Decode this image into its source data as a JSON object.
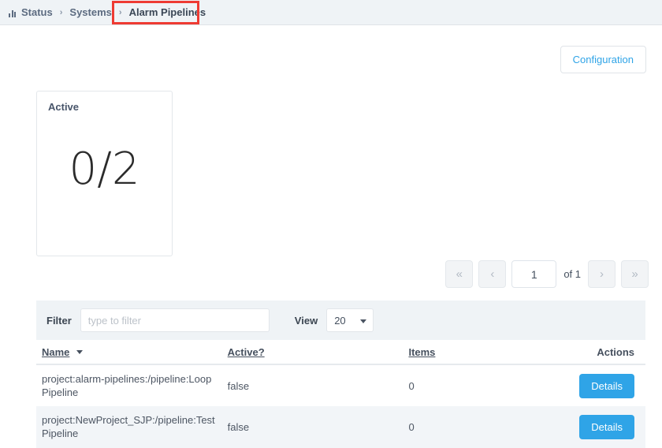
{
  "breadcrumb": {
    "icon": "bar-chart-icon",
    "items": [
      {
        "label": "Status",
        "current": false
      },
      {
        "label": "Systems",
        "current": false
      },
      {
        "label": "Alarm Pipelines",
        "current": true
      }
    ],
    "separator": "›",
    "highlight_color": "#ee3b33"
  },
  "toolbar": {
    "configuration_label": "Configuration"
  },
  "card": {
    "title": "Active",
    "value": "0/2"
  },
  "pagination": {
    "first_label": "«",
    "prev_label": "‹",
    "page_value": "1",
    "of_label": "of 1",
    "next_label": "›",
    "last_label": "»"
  },
  "filter": {
    "label": "Filter",
    "placeholder": "type to filter",
    "value": "",
    "view_label": "View",
    "view_value": "20"
  },
  "table": {
    "columns": [
      {
        "label": "Name",
        "sortable": true,
        "sorted": true
      },
      {
        "label": "Active?",
        "sortable": true,
        "sorted": false
      },
      {
        "label": "Items",
        "sortable": true,
        "sorted": false
      },
      {
        "label": "Actions",
        "sortable": false,
        "sorted": false
      }
    ],
    "rows": [
      {
        "name": "project:alarm-pipelines:/pipeline:Loop Pipeline",
        "active": "false",
        "items": "0",
        "action_label": "Details"
      },
      {
        "name": "project:NewProject_SJP:/pipeline:Test Pipeline",
        "active": "false",
        "items": "0",
        "action_label": "Details"
      }
    ]
  },
  "colors": {
    "accent": "#2fa4e7",
    "annotation": "#ee3b33",
    "panel": "#eff3f6"
  }
}
